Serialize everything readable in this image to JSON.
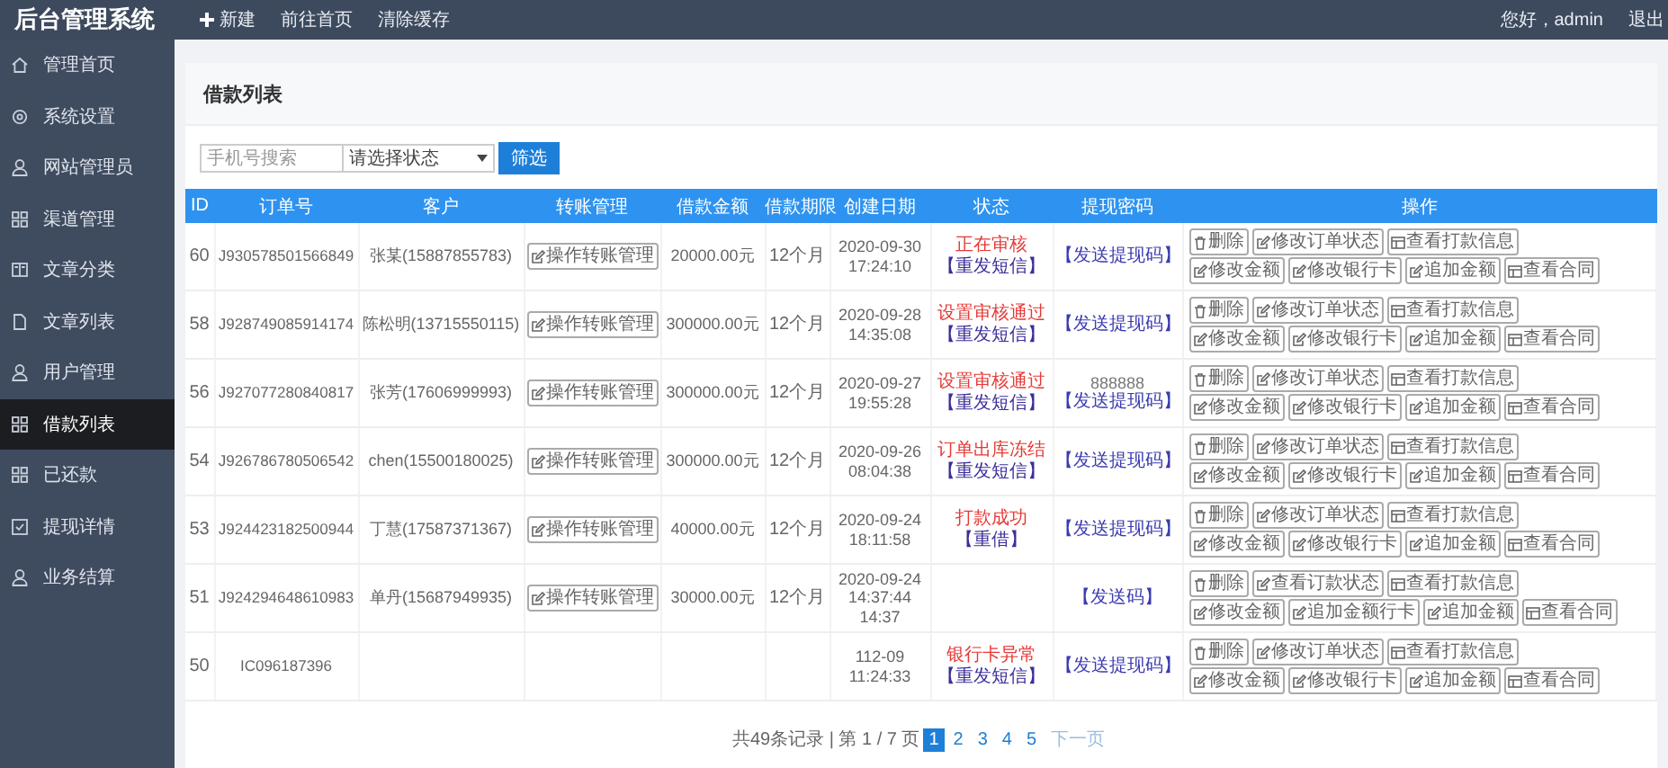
{
  "topbar": {
    "brand": "后台管理系统",
    "links": [
      {
        "label": "新建",
        "kind": "plus"
      },
      {
        "label": "前往首页",
        "kind": "text"
      },
      {
        "label": "清除缓存",
        "kind": "text"
      }
    ],
    "greeting": "您好，admin",
    "logout": "退出"
  },
  "sidebar": {
    "items": [
      {
        "label": "管理首页",
        "kind": "home",
        "selected": false
      },
      {
        "label": "系统设置",
        "kind": "gear",
        "selected": false
      },
      {
        "label": "网站管理员",
        "kind": "person",
        "selected": false
      },
      {
        "label": "渠道管理",
        "kind": "grid",
        "selected": false
      },
      {
        "label": "文章分类",
        "kind": "book",
        "selected": false
      },
      {
        "label": "文章列表",
        "kind": "file",
        "selected": false
      },
      {
        "label": "用户管理",
        "kind": "person",
        "selected": false
      },
      {
        "label": "借款列表",
        "kind": "grid",
        "selected": true
      },
      {
        "label": "已还款",
        "kind": "grid",
        "selected": false
      },
      {
        "label": "提现详情",
        "kind": "check",
        "selected": false
      },
      {
        "label": "业务结算",
        "kind": "person",
        "selected": false
      }
    ]
  },
  "card": {
    "title": "借款列表"
  },
  "filter": {
    "search": {
      "placeholder": "手机号搜索"
    },
    "select": "请选择状态",
    "button": "筛选"
  },
  "table": {
    "columns": [
      "ID",
      "订单号",
      "客户",
      "转账管理",
      "借款金额",
      "借款期限",
      "创建日期",
      "状态",
      "提现密码",
      "操作"
    ],
    "rows": [
      {
        "id": "60",
        "order": "J930578501566849",
        "customer": "张某(15887855783)",
        "manage": "操作转账管理",
        "amount": "20000.00元",
        "term": "12个月",
        "date": "2020-09-30 17:24:10",
        "status": "正在审核",
        "sms": "【重发短信】",
        "code": "【发送提现码】",
        "actions": [
          [
            {
              "label": "删除",
              "kind": "trash"
            },
            {
              "label": "修改订单状态",
              "kind": "edit"
            },
            {
              "label": "查看打款信息",
              "kind": "table"
            }
          ],
          [
            {
              "label": "修改金额",
              "kind": "edit"
            },
            {
              "label": "修改银行卡",
              "kind": "edit"
            },
            {
              "label": "追加金额",
              "kind": "edit"
            },
            {
              "label": "查看合同",
              "kind": "table"
            }
          ]
        ]
      },
      {
        "id": "58",
        "order": "J928749085914174",
        "customer": "陈松明(13715550115)",
        "manage": "操作转账管理",
        "amount": "300000.00元",
        "term": "12个月",
        "date": "2020-09-28 14:35:08",
        "status": "设置审核通过",
        "sms": "【重发短信】",
        "code": "【发送提现码】",
        "actions": [
          [
            {
              "label": "删除",
              "kind": "trash"
            },
            {
              "label": "修改订单状态",
              "kind": "edit"
            },
            {
              "label": "查看打款信息",
              "kind": "table"
            }
          ],
          [
            {
              "label": "修改金额",
              "kind": "edit"
            },
            {
              "label": "修改银行卡",
              "kind": "edit"
            },
            {
              "label": "追加金额",
              "kind": "edit"
            },
            {
              "label": "查看合同",
              "kind": "table"
            }
          ]
        ]
      },
      {
        "id": "56",
        "order": "J927077280840817",
        "customer": "张芳(17606999993)",
        "manage": "操作转账管理",
        "amount": "300000.00元",
        "term": "12个月",
        "date": "2020-09-27 19:55:28",
        "status": "设置审核通过",
        "sms": "【重发短信】",
        "code_value": "888888",
        "code": "【发送提现码】",
        "actions": [
          [
            {
              "label": "删除",
              "kind": "trash"
            },
            {
              "label": "修改订单状态",
              "kind": "edit"
            },
            {
              "label": "查看打款信息",
              "kind": "table"
            }
          ],
          [
            {
              "label": "修改金额",
              "kind": "edit"
            },
            {
              "label": "修改银行卡",
              "kind": "edit"
            },
            {
              "label": "追加金额",
              "kind": "edit"
            },
            {
              "label": "查看合同",
              "kind": "table"
            }
          ]
        ]
      },
      {
        "id": "54",
        "order": "J926786780506542",
        "customer": "chen(15500180025)",
        "manage": "操作转账管理",
        "amount": "300000.00元",
        "term": "12个月",
        "date": "2020-09-26 08:04:38",
        "status": "订单出库冻结",
        "sms": "【重发短信】",
        "code": "【发送提现码】",
        "actions": [
          [
            {
              "label": "删除",
              "kind": "trash"
            },
            {
              "label": "修改订单状态",
              "kind": "edit"
            },
            {
              "label": "查看打款信息",
              "kind": "table"
            }
          ],
          [
            {
              "label": "修改金额",
              "kind": "edit"
            },
            {
              "label": "修改银行卡",
              "kind": "edit"
            },
            {
              "label": "追加金额",
              "kind": "edit"
            },
            {
              "label": "查看合同",
              "kind": "table"
            }
          ]
        ]
      },
      {
        "id": "53",
        "order": "J924423182500944",
        "customer": "丁慧(17587371367)",
        "manage": "操作转账管理",
        "amount": "40000.00元",
        "term": "12个月",
        "date": "2020-09-24 18:11:58",
        "status": "打款成功",
        "sms": "【重借】",
        "code": "【发送提现码】",
        "actions": [
          [
            {
              "label": "删除",
              "kind": "trash"
            },
            {
              "label": "修改订单状态",
              "kind": "edit"
            },
            {
              "label": "查看打款信息",
              "kind": "table"
            }
          ],
          [
            {
              "label": "修改金额",
              "kind": "edit"
            },
            {
              "label": "修改银行卡",
              "kind": "edit"
            },
            {
              "label": "追加金额",
              "kind": "edit"
            },
            {
              "label": "查看合同",
              "kind": "table"
            }
          ]
        ]
      },
      {
        "id": "51",
        "order": "J924294648610983",
        "customer": "单丹(15687949935)",
        "manage": "操作转账管理",
        "amount": "30000.00元",
        "term": "12个月",
        "date": "2020-09-24 14:37:44",
        "date_extra": "14:37",
        "code": "【发送码】",
        "actions": [
          [
            {
              "label": "删除",
              "kind": "trash"
            },
            {
              "label": "查看订款状态",
              "kind": "edit"
            },
            {
              "label": "查看打款信息",
              "kind": "table"
            }
          ],
          [
            {
              "label": "修改金额",
              "kind": "edit"
            },
            {
              "label": "追加金额行卡",
              "kind": "edit"
            },
            {
              "label": "追加金额",
              "kind": "edit"
            },
            {
              "label": "查看合同",
              "kind": "table"
            }
          ]
        ]
      },
      {
        "id": "50",
        "order": "IC096187396",
        "date": "112-09 11:24:33",
        "status": "银行卡异常",
        "sms": "【重发短信】",
        "code": "【发送提现码】",
        "actions": [
          [
            {
              "label": "删除",
              "kind": "trash"
            },
            {
              "label": "修改订单状态",
              "kind": "edit"
            },
            {
              "label": "查看打款信息",
              "kind": "table"
            }
          ],
          [
            {
              "label": "修改金额",
              "kind": "edit"
            },
            {
              "label": "修改银行卡",
              "kind": "edit"
            },
            {
              "label": "追加金额",
              "kind": "edit"
            },
            {
              "label": "查看合同",
              "kind": "table"
            }
          ]
        ]
      }
    ]
  },
  "pagination": {
    "summary": "共49条记录 | 第 1 / 7 页",
    "pages": [
      {
        "label": "1",
        "selected": true
      },
      {
        "label": "2",
        "selected": false
      },
      {
        "label": "3",
        "selected": false
      },
      {
        "label": "4",
        "selected": false
      },
      {
        "label": "5",
        "selected": false
      }
    ],
    "next": "下一页"
  }
}
